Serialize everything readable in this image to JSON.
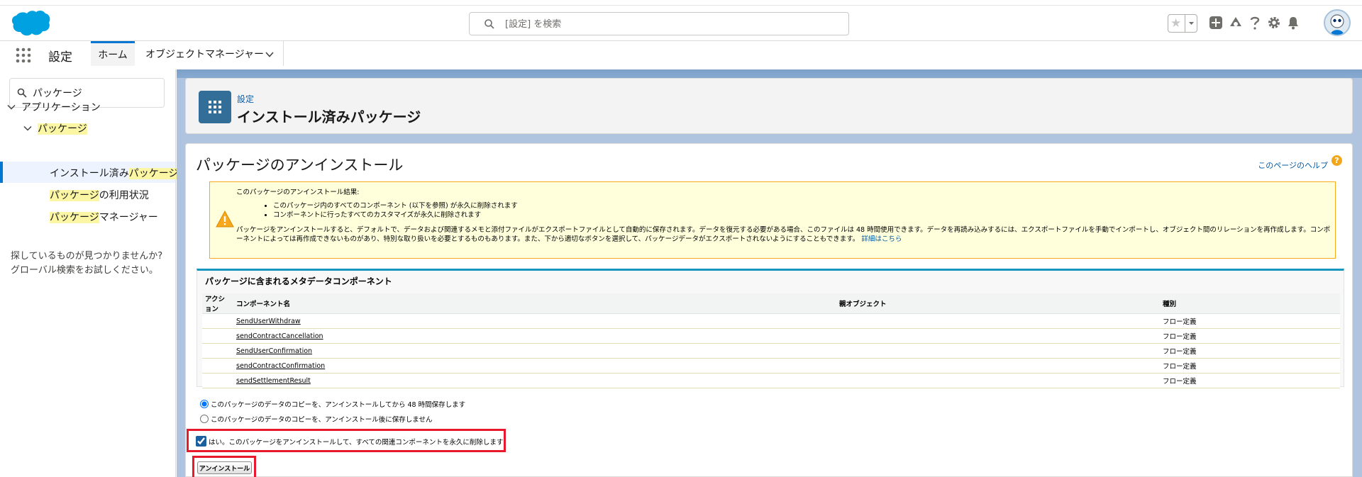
{
  "header": {
    "search_placeholder": "[設定] を検索"
  },
  "nav": {
    "app_name": "設定",
    "tabs": [
      {
        "label": "ホーム"
      },
      {
        "label": "オブジェクトマネージャー"
      }
    ]
  },
  "sidebar": {
    "search_value": "パッケージ",
    "tree": {
      "applications": "アプリケーション",
      "packages": "パッケージ",
      "installed_prefix": "インストール済み",
      "installed_hl": "パッケージ",
      "usage_hl": "パッケージ",
      "usage_suffix": "の利用状況",
      "manager_hl": "パッケージ",
      "manager_suffix": "マネージャー"
    },
    "not_found_line1": "探しているものが見つかりませんか?",
    "not_found_line2": "グローバル検索をお試しください。"
  },
  "page_header": {
    "breadcrumb": "設定",
    "title": "インストール済みパッケージ"
  },
  "uninstall": {
    "title": "パッケージのアンインストール",
    "help_link": "このページのヘルプ",
    "warning": {
      "heading": "このパッケージのアンインストール結果:",
      "bullet1": "このパッケージ内のすべてのコンポーネント (以下を参照) が永久に削除されます",
      "bullet2": "コンポーネントに行ったすべてのカスタマイズが永久に削除されます",
      "body": "パッケージをアンインストールすると、デフォルトで、データおよび関連するメモと添付ファイルがエクスポートファイルとして自動的に保存されます。データを復元する必要がある場合、このファイルは 48 時間使用できます。データを再読み込みするには、エクスポートファイルを手動でインポートし、オブジェクト間のリレーションを再作成します。コンポーネントによっては再作成できないものがあり、特別な取り扱いを必要とするものもあります。また、下から適切なボタンを選択して、パッケージデータがエクスポートされないようにすることもできます。",
      "detail_link": "詳細はこちら"
    },
    "meta_section": {
      "title": "パッケージに含まれるメタデータコンポーネント",
      "columns": [
        "アクション",
        "コンポーネント名",
        "親オブジェクト",
        "種別"
      ],
      "rows": [
        {
          "name": "SendUserWithdraw",
          "parent": "",
          "type": "フロー定義"
        },
        {
          "name": "sendContractCancellation",
          "parent": "",
          "type": "フロー定義"
        },
        {
          "name": "SendUserConfirmation",
          "parent": "",
          "type": "フロー定義"
        },
        {
          "name": "sendContractConfirmation",
          "parent": "",
          "type": "フロー定義"
        },
        {
          "name": "sendSettlementResult",
          "parent": "",
          "type": "フロー定義"
        }
      ]
    },
    "option_save": "このパッケージのデータのコピーを、アンインストールしてから 48 時間保存します",
    "option_nosave": "このパッケージのデータのコピーを、アンインストール後に保存しません",
    "confirm_label": "はい。このパッケージをアンインストールして、すべての関連コンポーネントを永久に削除します",
    "button_label": "アンインストール"
  },
  "colors": {
    "brand_blue": "#0176d3",
    "highlight_red": "#e8192c",
    "warning_bg": "#ffffdc",
    "page_icon": "#336e99"
  }
}
